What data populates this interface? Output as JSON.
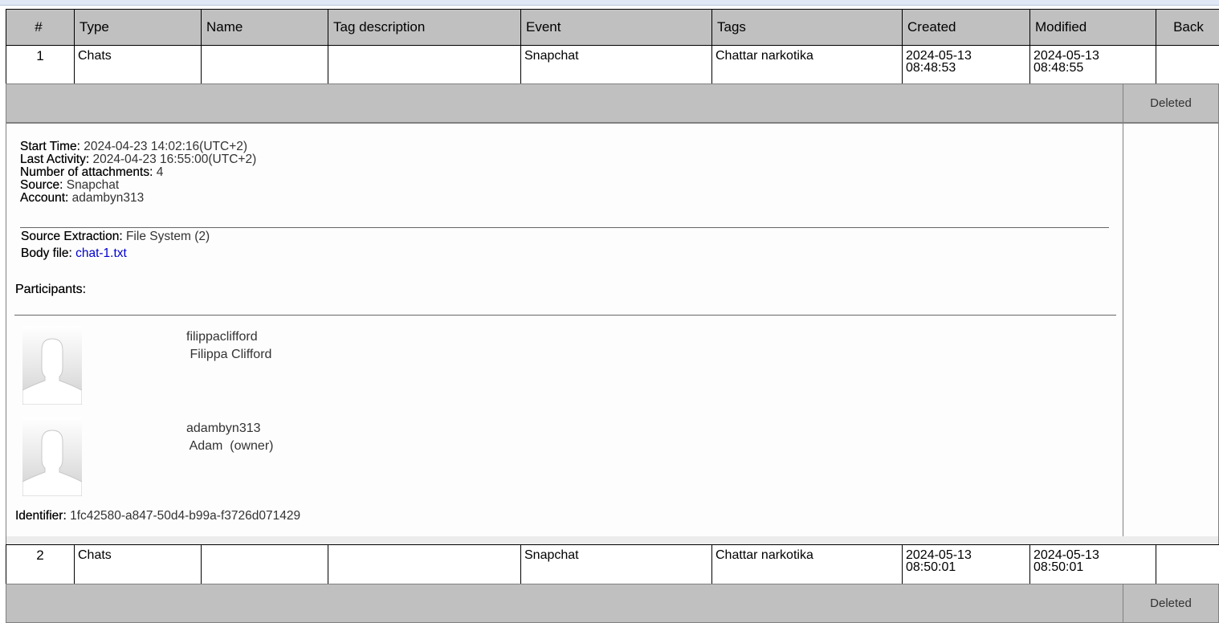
{
  "columns": [
    "#",
    "Type",
    "Name",
    "Tag description",
    "Event",
    "Tags",
    "Created",
    "Modified",
    "Back"
  ],
  "records": [
    {
      "num": "1",
      "type": "Chats",
      "name": "",
      "tag_description": "",
      "event": "Snapchat",
      "tags": "Chattar narkotika",
      "created_date": "2024-05-13",
      "created_time": "08:48:53",
      "modified_date": "2024-05-13",
      "modified_time": "08:48:55",
      "back": "",
      "status": "Deleted"
    },
    {
      "num": "2",
      "type": "Chats",
      "name": "",
      "tag_description": "",
      "event": "Snapchat",
      "tags": "Chattar narkotika",
      "created_date": "2024-05-13",
      "created_time": "08:50:01",
      "modified_date": "2024-05-13",
      "modified_time": "08:50:01",
      "back": "",
      "status": "Deleted"
    }
  ],
  "detail": {
    "start_time_label": "Start Time:",
    "start_time": " 2024-04-23 14:02:16(UTC+2)",
    "last_activity_label": "Last Activity:",
    "last_activity": " 2024-04-23 16:55:00(UTC+2)",
    "attachments_label": "Number of attachments:",
    "attachments": " 4",
    "source_label": "Source:",
    "source": " Snapchat",
    "account_label": "Account:",
    "account": " adambyn313",
    "extraction_label": "Source Extraction:",
    "extraction": " File System (2)",
    "body_file_label": "Body file:",
    "body_file": "chat-1.txt",
    "participants_label": "Participants:",
    "participants": [
      {
        "username": "filippaclifford",
        "display": " Filippa Clifford"
      },
      {
        "username": "adambyn313",
        "display": " Adam  (owner)"
      }
    ],
    "identifier_label": "Identifier:",
    "identifier": " 1fc42580-a847-50d4-b99a-f3726d071429"
  }
}
